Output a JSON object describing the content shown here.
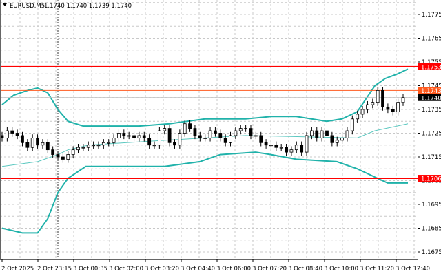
{
  "header": {
    "symbol": "EURUSD,M5",
    "ohlc": "1.1740 1.1740 1.1739 1.1740"
  },
  "colors": {
    "bands": "#20b2aa",
    "middle": "#5cc8c0",
    "level_red": "#ff0000",
    "level_orange": "#ff5a1e",
    "bid_line": "#c0c0c0",
    "grid": "#c8c8c8"
  },
  "chart_data": {
    "type": "candlestick",
    "title": "",
    "symbol": "EURUSD,M5",
    "ylim": [
      1.1668,
      1.1781
    ],
    "y_ticks": [
      "1.1775",
      "1.1765",
      "1.1755",
      "1.1745",
      "1.1735",
      "1.1725",
      "1.1715",
      "1.1705",
      "1.1695",
      "1.1685",
      "1.1675"
    ],
    "x_ticks": [
      "2 Oct 2025",
      "2 Oct 23:15",
      "3 Oct 00:35",
      "3 Oct 02:00",
      "3 Oct 03:20",
      "3 Oct 04:40",
      "3 Oct 06:00",
      "3 Oct 07:20",
      "3 Oct 08:40",
      "3 Oct 10:00",
      "3 Oct 11:20",
      "3 Oct 12:40"
    ],
    "grid": true,
    "closes": [
      1.1723,
      1.1726,
      1.1725,
      1.1724,
      1.1721,
      1.1719,
      1.1723,
      1.172,
      1.1721,
      1.1718,
      1.1716,
      1.1715,
      1.1714,
      1.1716,
      1.1718,
      1.1719,
      1.1719,
      1.172,
      1.172,
      1.172,
      1.1721,
      1.1721,
      1.1723,
      1.1725,
      1.1724,
      1.1724,
      1.1723,
      1.1724,
      1.1723,
      1.172,
      1.172,
      1.1726,
      1.1727,
      1.1721,
      1.172,
      1.1725,
      1.1729,
      1.1727,
      1.1724,
      1.1723,
      1.1723,
      1.1726,
      1.1725,
      1.1723,
      1.1721,
      1.1724,
      1.1726,
      1.1727,
      1.1727,
      1.1724,
      1.1724,
      1.1721,
      1.172,
      1.172,
      1.1719,
      1.1719,
      1.1717,
      1.1718,
      1.172,
      1.1717,
      1.1724,
      1.1726,
      1.1723,
      1.1726,
      1.1724,
      1.1721,
      1.1722,
      1.1723,
      1.1726,
      1.1731,
      1.1733,
      1.1735,
      1.1737,
      1.1738,
      1.1743,
      1.1736,
      1.1735,
      1.1734,
      1.1738,
      1.174
    ],
    "bollinger": {
      "upper": [
        [
          0,
          1.1737
        ],
        [
          2.3,
          1.1741
        ],
        [
          5,
          1.1743
        ],
        [
          7,
          1.1744
        ],
        [
          9,
          1.1742
        ],
        [
          11,
          1.1735
        ],
        [
          13,
          1.173
        ],
        [
          16,
          1.1728
        ],
        [
          27,
          1.1728
        ],
        [
          33,
          1.1729
        ],
        [
          40,
          1.1731
        ],
        [
          48,
          1.1731
        ],
        [
          53,
          1.1732
        ],
        [
          58,
          1.1732
        ],
        [
          64,
          1.173
        ],
        [
          67,
          1.1731
        ],
        [
          70,
          1.1734
        ],
        [
          73.5,
          1.1745
        ],
        [
          75.5,
          1.1748
        ],
        [
          78,
          1.175
        ],
        [
          80,
          1.1752
        ]
      ],
      "middle": [
        [
          0,
          1.1711
        ],
        [
          7,
          1.1713
        ],
        [
          11,
          1.1716
        ],
        [
          13,
          1.1718
        ],
        [
          17,
          1.172
        ],
        [
          32,
          1.1722
        ],
        [
          48,
          1.1724
        ],
        [
          70,
          1.1723
        ],
        [
          73.5,
          1.1726
        ],
        [
          80,
          1.1729
        ]
      ],
      "lower": [
        [
          0,
          1.1685
        ],
        [
          4,
          1.1683
        ],
        [
          7,
          1.1683
        ],
        [
          9,
          1.1689
        ],
        [
          11,
          1.17
        ],
        [
          13,
          1.1706
        ],
        [
          16.5,
          1.1711
        ],
        [
          32,
          1.1711
        ],
        [
          39,
          1.1713
        ],
        [
          43,
          1.1716
        ],
        [
          50,
          1.1717
        ],
        [
          53,
          1.1716
        ],
        [
          58,
          1.1714
        ],
        [
          66,
          1.1713
        ],
        [
          70,
          1.171
        ],
        [
          74,
          1.1706
        ],
        [
          76,
          1.1704
        ],
        [
          80,
          1.1704
        ]
      ]
    },
    "levels": [
      {
        "price": 1.1753,
        "label": "1.1753",
        "kind": "resistance",
        "color": "#ff0000"
      },
      {
        "price": 1.1743,
        "label": "1.1743",
        "kind": "level",
        "color": "#ff5a1e"
      },
      {
        "price": 1.174,
        "label": "1.1740",
        "kind": "bid",
        "color": "#000000"
      },
      {
        "price": 1.1706,
        "label": "1.1706",
        "kind": "support",
        "color": "#ff0000"
      }
    ]
  }
}
